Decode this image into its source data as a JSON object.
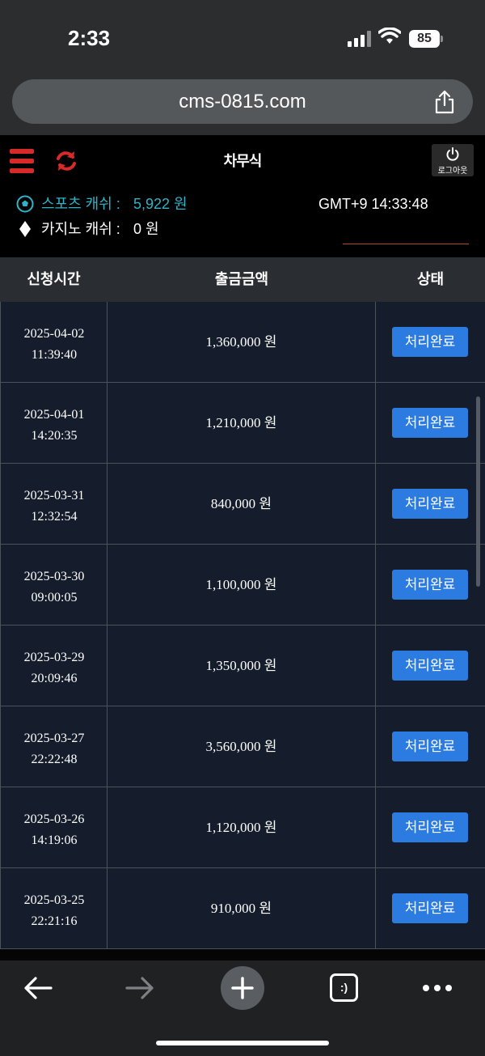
{
  "status_bar": {
    "time": "2:33",
    "battery": "85"
  },
  "browser": {
    "url": "cms-0815.com"
  },
  "header": {
    "logo_text": "차무식",
    "logout_label": "로그아웃",
    "sports_cash_label": "스포츠 캐쉬 :",
    "sports_cash_value": "5,922 원",
    "casino_cash_label": "카지노 캐쉬 :",
    "casino_cash_value": "0 원",
    "clock": "GMT+9 14:33:48",
    "colors": {
      "accent_red": "#d92a2a",
      "sports_teal": "#2fb3c8",
      "status_blue": "#2c7be0"
    }
  },
  "table": {
    "columns": [
      "신청시간",
      "출금금액",
      "상태"
    ],
    "rows": [
      {
        "date": "2025-04-02",
        "time": "11:39:40",
        "amount": "1,360,000 원",
        "status": "처리완료"
      },
      {
        "date": "2025-04-01",
        "time": "14:20:35",
        "amount": "1,210,000 원",
        "status": "처리완료"
      },
      {
        "date": "2025-03-31",
        "time": "12:32:54",
        "amount": "840,000 원",
        "status": "처리완료"
      },
      {
        "date": "2025-03-30",
        "time": "09:00:05",
        "amount": "1,100,000 원",
        "status": "처리완료"
      },
      {
        "date": "2025-03-29",
        "time": "20:09:46",
        "amount": "1,350,000 원",
        "status": "처리완료"
      },
      {
        "date": "2025-03-27",
        "time": "22:22:48",
        "amount": "3,560,000 원",
        "status": "처리완료"
      },
      {
        "date": "2025-03-26",
        "time": "14:19:06",
        "amount": "1,120,000 원",
        "status": "처리완료"
      },
      {
        "date": "2025-03-25",
        "time": "22:21:16",
        "amount": "910,000 원",
        "status": "처리완료"
      }
    ]
  },
  "toolbar": {
    "icons": [
      "back-arrow-icon",
      "forward-arrow-icon",
      "plus-icon",
      "tabs-icon",
      "more-icon"
    ],
    "tabs_glyph": ":)"
  }
}
